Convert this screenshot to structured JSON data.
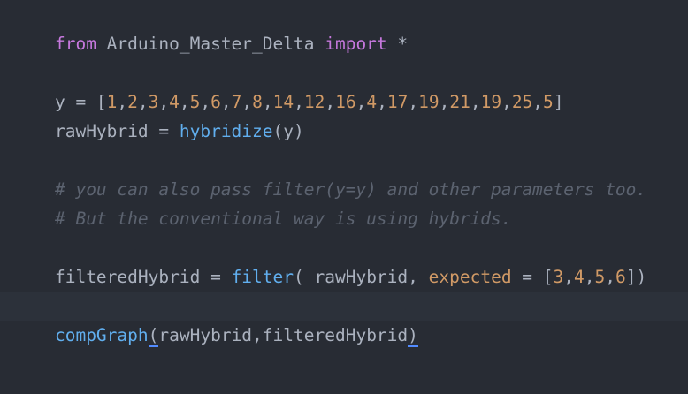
{
  "code": {
    "line1": {
      "kw_from": "from",
      "module": " Arduino_Master_Delta ",
      "kw_import": "import",
      "star": " *"
    },
    "line3": {
      "lhs": "y = [",
      "nums": [
        "1",
        "2",
        "3",
        "4",
        "5",
        "6",
        "7",
        "8",
        "14",
        "12",
        "16",
        "4",
        "17",
        "19",
        "21",
        "19",
        "25",
        "5"
      ],
      "close": "]"
    },
    "line4": {
      "lhs": "rawHybrid = ",
      "fn": "hybridize",
      "args": "(y)"
    },
    "line6": {
      "comment": "# you can also pass filter(y=y) and other parameters too."
    },
    "line7": {
      "comment": "# But the conventional way is using hybrids."
    },
    "line9": {
      "lhs": "filteredHybrid = ",
      "fn": "filter",
      "open": "( rawHybrid, ",
      "param": "expected",
      "eq": " = [",
      "nums": [
        "3",
        "4",
        "5",
        "6"
      ],
      "close": "])"
    },
    "line11": {
      "fn": "compGraph",
      "open_paren": "(",
      "args": "rawHybrid,filteredHybrid",
      "close_paren": ")"
    }
  },
  "colors": {
    "background": "#282c34",
    "keyword": "#c678dd",
    "function": "#61afef",
    "number": "#d19a66",
    "comment": "#5c6370",
    "plain": "#abb2bf"
  }
}
